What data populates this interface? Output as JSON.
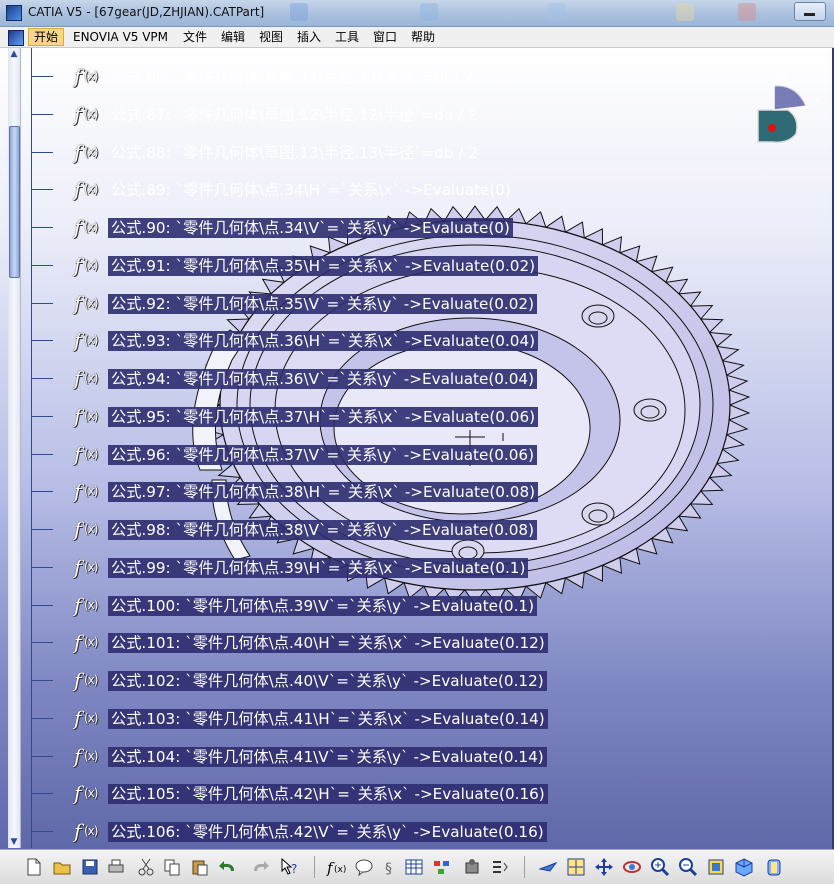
{
  "window": {
    "title": "CATIA V5 - [67gear(JD,ZHJIAN).CATPart]"
  },
  "menubar": {
    "items": [
      "开始",
      "ENOVIA V5 VPM",
      "文件",
      "编辑",
      "视图",
      "插入",
      "工具",
      "窗口",
      "帮助"
    ]
  },
  "compass": {
    "axis_x": "x",
    "axis_y": "y",
    "axis_z": "z"
  },
  "formulas": [
    {
      "label": "公式.86: `零件几何体\\草图.11\\半径.11\\半径`=df / 2",
      "highlighted": false
    },
    {
      "label": "公式.87: `零件几何体\\草图.12\\半径.12\\半径`=da / 2",
      "highlighted": false
    },
    {
      "label": "公式.88: `零件几何体\\草图.13\\半径.13\\半径`=db / 2",
      "highlighted": false
    },
    {
      "label": "公式.89: `零件几何体\\点.34\\H`=`关系\\x` ->Evaluate(0)",
      "highlighted": false
    },
    {
      "label": "公式.90: `零件几何体\\点.34\\V`=`关系\\y` ->Evaluate(0)",
      "highlighted": true
    },
    {
      "label": "公式.91: `零件几何体\\点.35\\H`=`关系\\x` ->Evaluate(0.02)",
      "highlighted": true
    },
    {
      "label": "公式.92: `零件几何体\\点.35\\V`=`关系\\y` ->Evaluate(0.02)",
      "highlighted": true
    },
    {
      "label": "公式.93: `零件几何体\\点.36\\H`=`关系\\x` ->Evaluate(0.04)",
      "highlighted": true
    },
    {
      "label": "公式.94: `零件几何体\\点.36\\V`=`关系\\y` ->Evaluate(0.04)",
      "highlighted": true
    },
    {
      "label": "公式.95: `零件几何体\\点.37\\H`=`关系\\x` ->Evaluate(0.06)",
      "highlighted": true
    },
    {
      "label": "公式.96: `零件几何体\\点.37\\V`=`关系\\y` ->Evaluate(0.06)",
      "highlighted": true
    },
    {
      "label": "公式.97: `零件几何体\\点.38\\H`=`关系\\x` ->Evaluate(0.08)",
      "highlighted": true
    },
    {
      "label": "公式.98: `零件几何体\\点.38\\V`=`关系\\y` ->Evaluate(0.08)",
      "highlighted": true
    },
    {
      "label": "公式.99: `零件几何体\\点.39\\H`=`关系\\x` ->Evaluate(0.1)",
      "highlighted": true
    },
    {
      "label": "公式.100: `零件几何体\\点.39\\V`=`关系\\y` ->Evaluate(0.1)",
      "highlighted": true
    },
    {
      "label": "公式.101: `零件几何体\\点.40\\H`=`关系\\x` ->Evaluate(0.12)",
      "highlighted": true
    },
    {
      "label": "公式.102: `零件几何体\\点.40\\V`=`关系\\y` ->Evaluate(0.12)",
      "highlighted": true
    },
    {
      "label": "公式.103: `零件几何体\\点.41\\H`=`关系\\x` ->Evaluate(0.14)",
      "highlighted": true
    },
    {
      "label": "公式.104: `零件几何体\\点.41\\V`=`关系\\y` ->Evaluate(0.14)",
      "highlighted": true
    },
    {
      "label": "公式.105: `零件几何体\\点.42\\H`=`关系\\x` ->Evaluate(0.16)",
      "highlighted": true
    },
    {
      "label": "公式.106: `零件几何体\\点.42\\V`=`关系\\y` ->Evaluate(0.16)",
      "highlighted": true
    }
  ],
  "toolbar": {
    "icons": [
      "new-document-icon",
      "open-folder-icon",
      "save-icon",
      "print-icon",
      "cut-icon",
      "copy-icon",
      "paste-icon",
      "undo-icon",
      "redo-icon",
      "whats-this-icon",
      "formula-icon",
      "knowledge-advisor-icon",
      "design-table-icon",
      "law-icon",
      "catalog-icon",
      "fly-mode-icon",
      "fit-all-icon",
      "pan-icon",
      "rotate-icon",
      "zoom-in-icon",
      "zoom-out-icon",
      "normal-view-icon",
      "isometric-view-icon",
      "shading-icon"
    ]
  },
  "colors": {
    "label_bg": "#2e2c70",
    "gear_fill": "#c9c8ec",
    "gear_stroke": "#111111",
    "tree_line": "#2f4a8e"
  }
}
